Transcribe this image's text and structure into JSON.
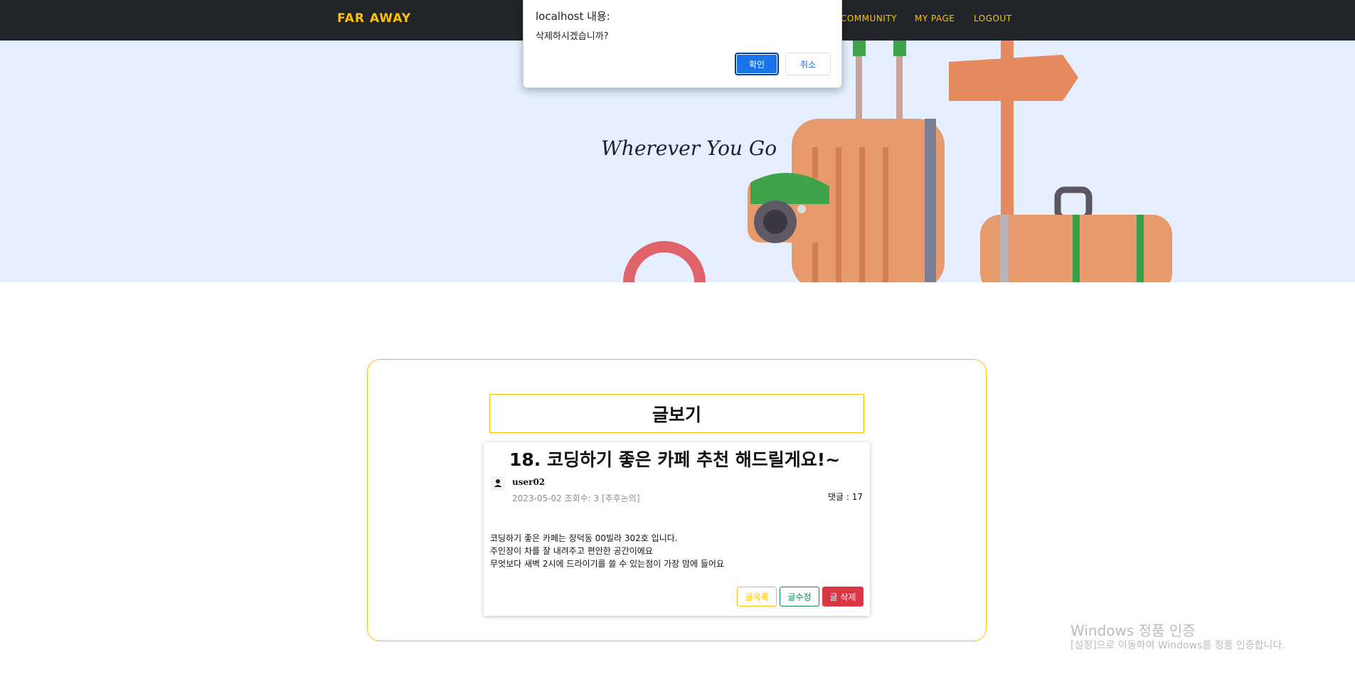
{
  "nav": {
    "brand": "FAR AWAY",
    "links": [
      "COMMUNITY",
      "MY PAGE",
      "LOGOUT"
    ]
  },
  "hero": {
    "tagline": "Wherever You Go"
  },
  "board": {
    "section_title": "글보기",
    "post": {
      "title": "18. 코딩하기 좋은 카페 추천 해드릴게요!~",
      "author": "user02",
      "meta": "2023-05-02 조회수: 3 [추후논의]",
      "comments": "댓글 : 17",
      "body_lines": [
        "코딩하기 좋은 카페는 장덕동 00빌라 302호 입니다.",
        "주인장이 차를 잘 내려주고 편안한 공간이에요",
        "무엇보다 새벽 2시에 드라이기를 쓸 수 있는점이 가장 맘에 들어요"
      ],
      "buttons": {
        "list": "글목록",
        "edit": "글수정",
        "delete": "글 삭제"
      }
    }
  },
  "dialog": {
    "title": "localhost 내용:",
    "message": "삭제하시겠습니까?",
    "ok": "확인",
    "cancel": "취소"
  },
  "watermark": {
    "line1": "Windows 정품 인증",
    "line2": "[설정]으로 이동하여 Windows를 정품 인증합니다."
  },
  "colors": {
    "accent": "#ffc107",
    "navbar": "#212529",
    "hero_bg": "#e6efff",
    "success": "#198754",
    "danger": "#dc3545",
    "dialog_primary": "#1a73e8"
  }
}
